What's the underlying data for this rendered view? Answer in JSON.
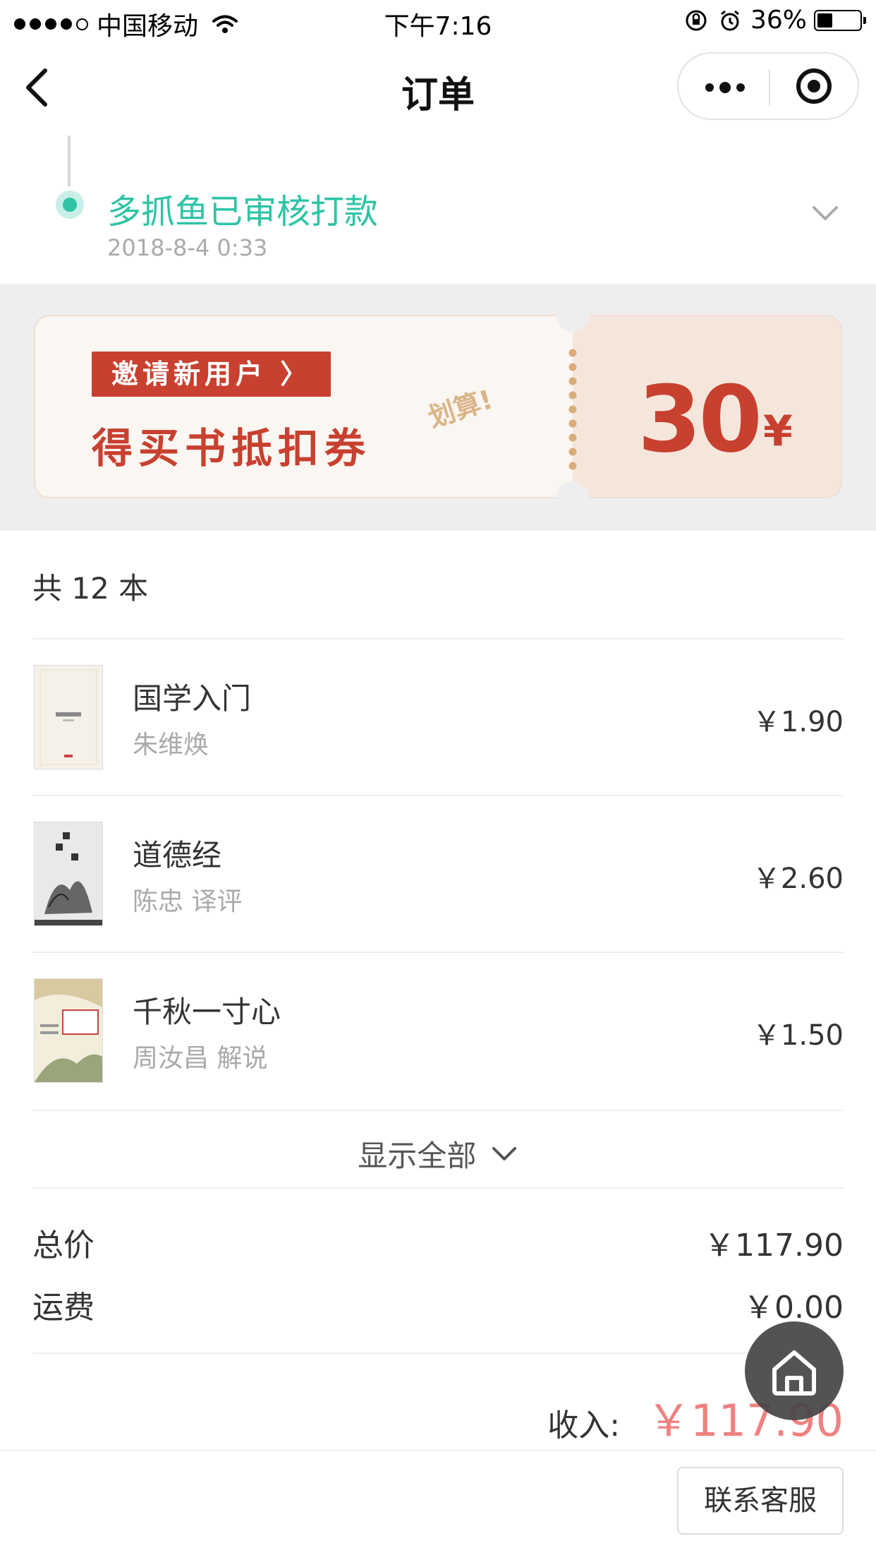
{
  "status_bar": {
    "carrier": "中国移动",
    "time": "下午7:16",
    "battery": "36%",
    "battery_level": 0.36
  },
  "nav": {
    "title": "订单"
  },
  "timeline": {
    "status": "多抓鱼已审核打款",
    "time": "2018-8-4 0:33",
    "accent_color": "#2ec4a5"
  },
  "coupon": {
    "tag": "邀请新用户 〉",
    "main_text": "得买书抵扣券",
    "deco_text": "划算!",
    "amount": "30",
    "currency": "¥",
    "brand_color": "#c8402f"
  },
  "order": {
    "count_label": "共 12 本",
    "books": [
      {
        "title": "国学入门",
        "author": "朱维焕",
        "price": "￥1.90"
      },
      {
        "title": "道德经",
        "author": "陈忠 译评",
        "price": "￥2.60"
      },
      {
        "title": "千秋一寸心",
        "author": "周汝昌 解说",
        "price": "￥1.50"
      }
    ],
    "show_all": "显示全部"
  },
  "summary": {
    "total_label": "总价",
    "total_value": "￥117.90",
    "shipping_label": "运费",
    "shipping_value": "￥0.00",
    "income_label": "收入:",
    "income_value": "￥117.90",
    "income_color": "#f08080"
  },
  "footer": {
    "contact_button": "联系客服"
  }
}
